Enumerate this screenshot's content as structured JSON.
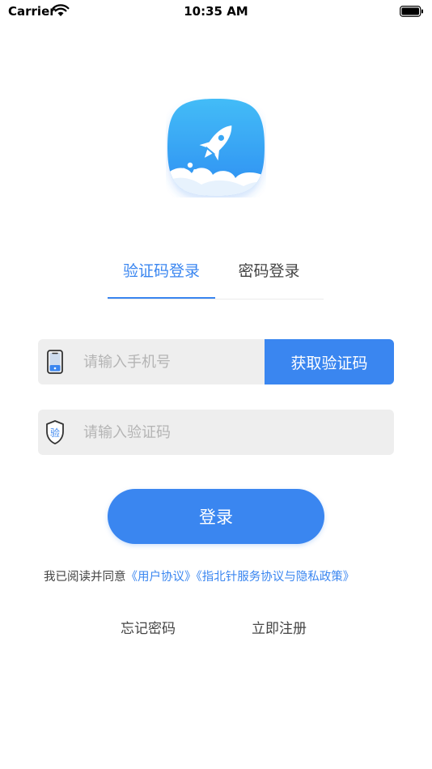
{
  "status_bar": {
    "carrier": "Carrier",
    "time": "10:35 AM",
    "icons": [
      "wifi-icon",
      "battery-icon"
    ]
  },
  "logo": {
    "icon": "rocket-icon",
    "gradient_top": "#41b5f5",
    "gradient_bottom": "#2f8ef2"
  },
  "tabs": [
    {
      "label": "验证码登录",
      "active": true
    },
    {
      "label": "密码登录",
      "active": false
    }
  ],
  "phone": {
    "icon": "phone-icon",
    "value": "",
    "placeholder": "请输入手机号",
    "get_code_label": "获取验证码"
  },
  "code": {
    "icon": "verify-shield-icon",
    "icon_text": "验",
    "value": "",
    "placeholder": "请输入验证码"
  },
  "login_label": "登录",
  "agreement": {
    "prefix": "我已阅读并同意",
    "user_agreement": "《用户协议》",
    "privacy_policy": "《指北针服务协议与隐私政策》"
  },
  "links": {
    "forgot_password": "忘记密码",
    "register": "立即注册"
  },
  "colors": {
    "accent": "#3a86f0",
    "field_bg": "#eeeeee",
    "placeholder": "#b4b4b4"
  }
}
